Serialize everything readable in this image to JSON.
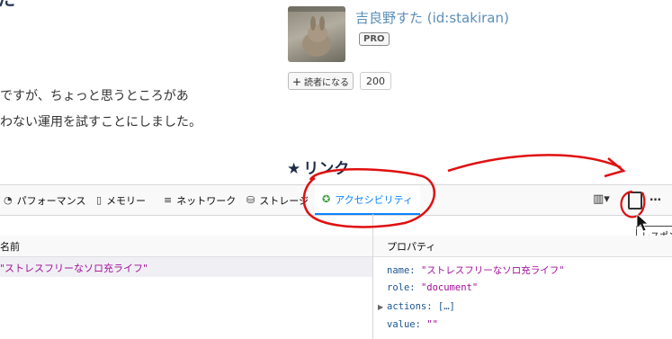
{
  "page": {
    "title_fragment": "た",
    "body_lines": [
      "ですが、ちょっと思うところがあ",
      "わない運用を試すことにしました。"
    ],
    "profile_name": "吉良野すた (id:stakiran)",
    "pro_badge": "PRO",
    "reader_button": "読者になる",
    "reader_count": "200",
    "link_heading": "リンク",
    "link_star": "★"
  },
  "devtools": {
    "tabs": [
      {
        "label": "パフォーマンス",
        "icon": "performance-icon"
      },
      {
        "label": "メモリー",
        "icon": "memory-icon"
      },
      {
        "label": "ネットワーク",
        "icon": "network-icon"
      },
      {
        "label": "ストレージ",
        "icon": "storage-icon"
      },
      {
        "label": "アクセシビリティ",
        "icon": "accessibility-icon",
        "active": true
      }
    ],
    "columns": {
      "left": "名前",
      "right": "プロパティ"
    },
    "tree_row": "\"ストレスフリーなソロ充ライフ\"",
    "properties": [
      {
        "key": "name:",
        "value": "\"ストレスフリーなソロ充ライフ\""
      },
      {
        "key": "role:",
        "value": "\"document\""
      },
      {
        "key": "actions:",
        "value": "[…]"
      },
      {
        "key": "value:",
        "value": "\"\""
      }
    ],
    "tooltip": "レスポン",
    "more_icon": "…",
    "layout_icon_glyph": "▥▾"
  },
  "colors": {
    "accent_blue": "#0a84ff",
    "annotation_red": "#e01010",
    "string_purple": "#a30d9b",
    "key_blue": "#1b5592"
  }
}
